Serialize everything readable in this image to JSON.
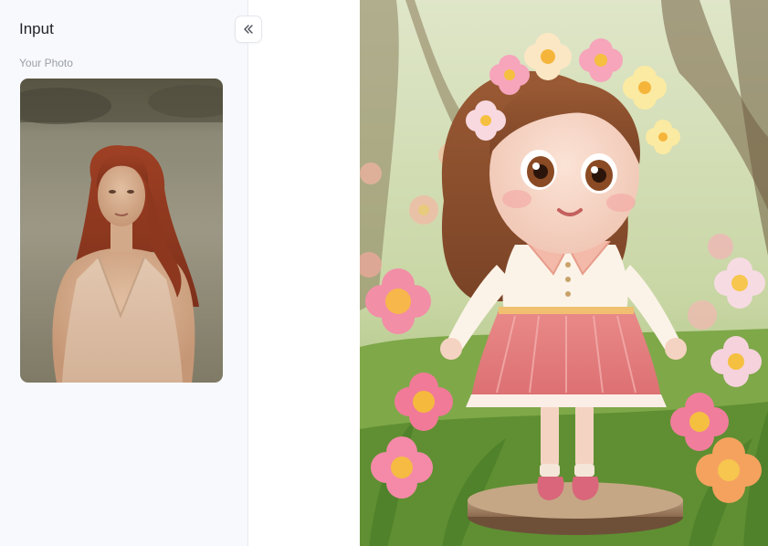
{
  "panel": {
    "title": "Input",
    "collapse_icon": "double-chevron-left-icon",
    "section_label": "Your Photo"
  },
  "input_photo": {
    "description_icon": "photo-thumbnail"
  },
  "result": {
    "image_icon": "generated-doll-image"
  }
}
